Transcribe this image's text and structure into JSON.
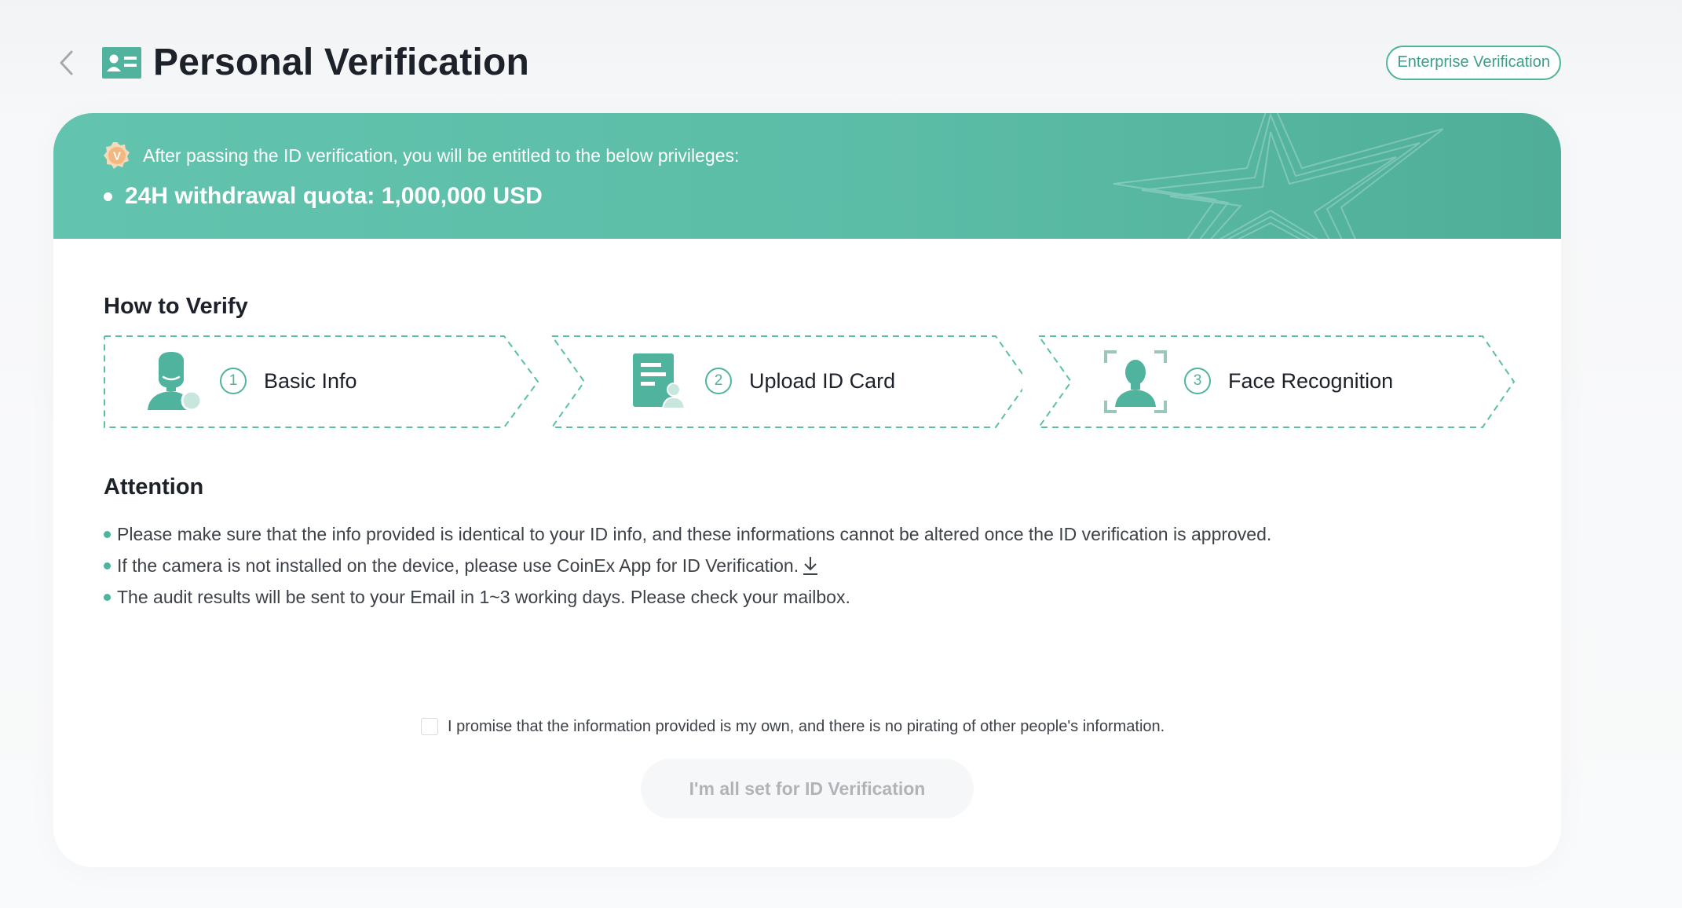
{
  "header": {
    "back_icon": "chevron-left-icon",
    "title_icon": "id-card-icon",
    "title": "Personal Verification",
    "enterprise_button": "Enterprise Verification"
  },
  "banner": {
    "badge_icon": "v-badge-icon",
    "badge_letter": "V",
    "privilege_text": "After passing the ID verification, you will be entitled to the below privileges:",
    "quota_text": "24H withdrawal quota: 1,000,000 USD"
  },
  "how_to_verify": {
    "title": "How to Verify",
    "steps": [
      {
        "number": "1",
        "label": "Basic Info",
        "icon": "person-icon"
      },
      {
        "number": "2",
        "label": "Upload ID Card",
        "icon": "id-document-icon"
      },
      {
        "number": "3",
        "label": "Face Recognition",
        "icon": "face-scan-icon"
      }
    ]
  },
  "attention": {
    "title": "Attention",
    "items": [
      "Please make sure that the info provided is identical to your ID info, and these informations cannot be altered once the ID verification is approved.",
      "If the camera is not installed on the device, please use CoinEx App for ID Verification.",
      "The audit results will be sent to your Email in 1~3 working days. Please check your mailbox."
    ],
    "download_icon": "download-icon"
  },
  "promise": {
    "checked": false,
    "text": "I promise that the information provided is my own, and there is no pirating of other people's information."
  },
  "submit_button": {
    "label": "I'm all set for ID Verification",
    "disabled": true
  },
  "colors": {
    "accent": "#4fb39d",
    "banner_start": "#62c4ae",
    "banner_end": "#4fae98",
    "badge": "#f2b880",
    "disabled_text": "#b0b4b9"
  }
}
